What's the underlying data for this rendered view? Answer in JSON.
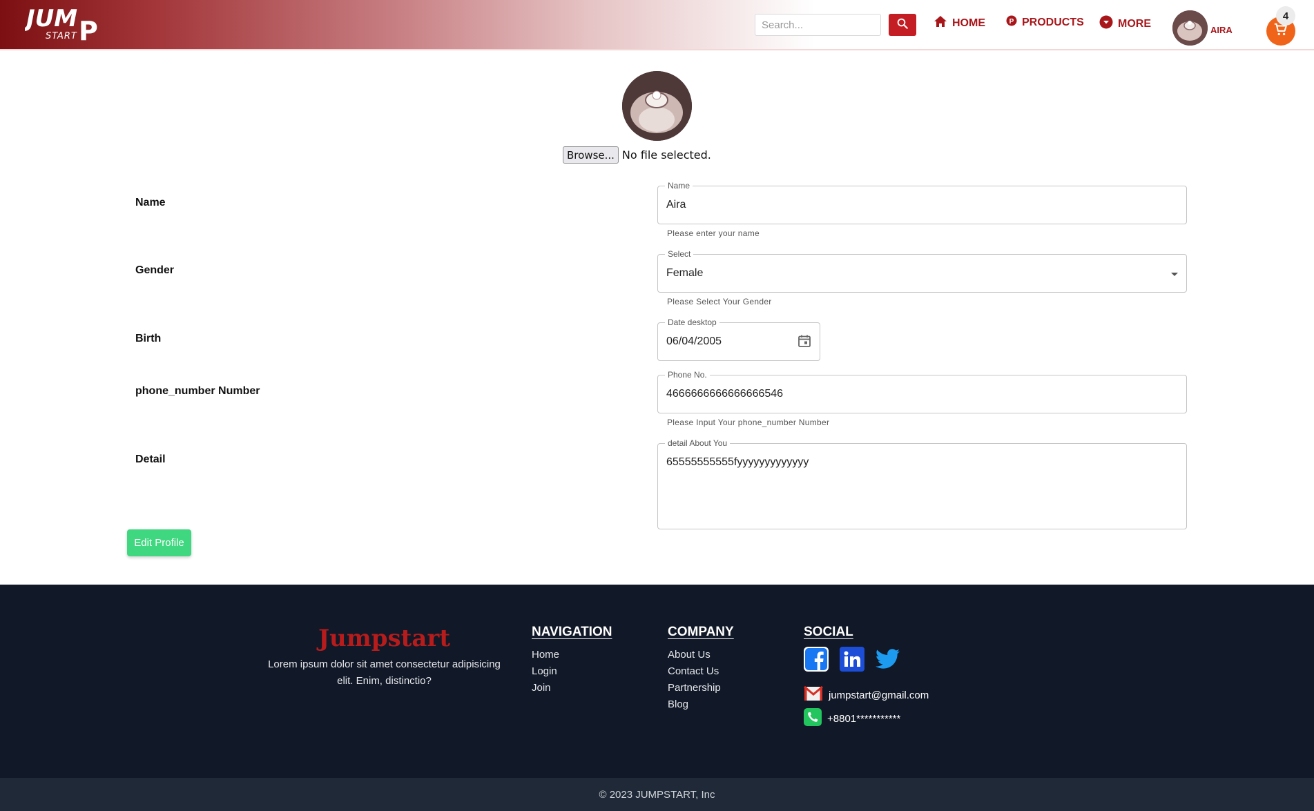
{
  "header": {
    "logo_text": "JUMP START",
    "search_placeholder": "Search...",
    "nav": [
      {
        "label": "HOME",
        "icon": "home-icon"
      },
      {
        "label": "PRODUCTS",
        "icon": "products-icon"
      },
      {
        "label": "MORE",
        "icon": "chevron-down-icon"
      }
    ],
    "user_name": "AIRA",
    "cart_count": "4",
    "colors": {
      "brand_red": "#a8161a",
      "cart_orange": "#f0641a"
    }
  },
  "profile": {
    "browse_label": "Browse...",
    "file_status": "No file selected."
  },
  "form": {
    "labels": {
      "name": "Name",
      "gender": "Gender",
      "birth": "Birth",
      "phone": "phone_number Number",
      "detail": "Detail"
    },
    "name": {
      "legend": "Name",
      "value": "Aira",
      "helper": "Please enter your name"
    },
    "gender": {
      "legend": "Select",
      "value": "Female",
      "helper": "Please Select Your Gender"
    },
    "birth": {
      "legend": "Date desktop",
      "value": "06/04/2005"
    },
    "phone": {
      "legend": "Phone No.",
      "value": "4666666666666666546",
      "helper": "Please Input Your phone_number Number"
    },
    "detail": {
      "legend": "detail About You",
      "value": "65555555555fyyyyyyyyyyyyy"
    },
    "submit_label": "Edit Profile",
    "submit_color": "#3fd77f"
  },
  "footer": {
    "brand": "Jumpstart",
    "description": "Lorem ipsum dolor sit amet consectetur adipisicing elit. Enim, distinctio?",
    "navigation": {
      "title": "NAVIGATION",
      "links": [
        "Home",
        "Login",
        "Join"
      ]
    },
    "company": {
      "title": "COMPANY",
      "links": [
        "About Us",
        "Contact Us",
        "Partnership",
        "Blog"
      ]
    },
    "social": {
      "title": "SOCIAL",
      "icons": [
        "facebook-icon",
        "linkedin-icon",
        "twitter-icon"
      ],
      "email": "jumpstart@gmail.com",
      "phone": "+8801***********"
    },
    "copyright": "© 2023 JUMPSTART, Inc",
    "bg_color": "#111827"
  }
}
